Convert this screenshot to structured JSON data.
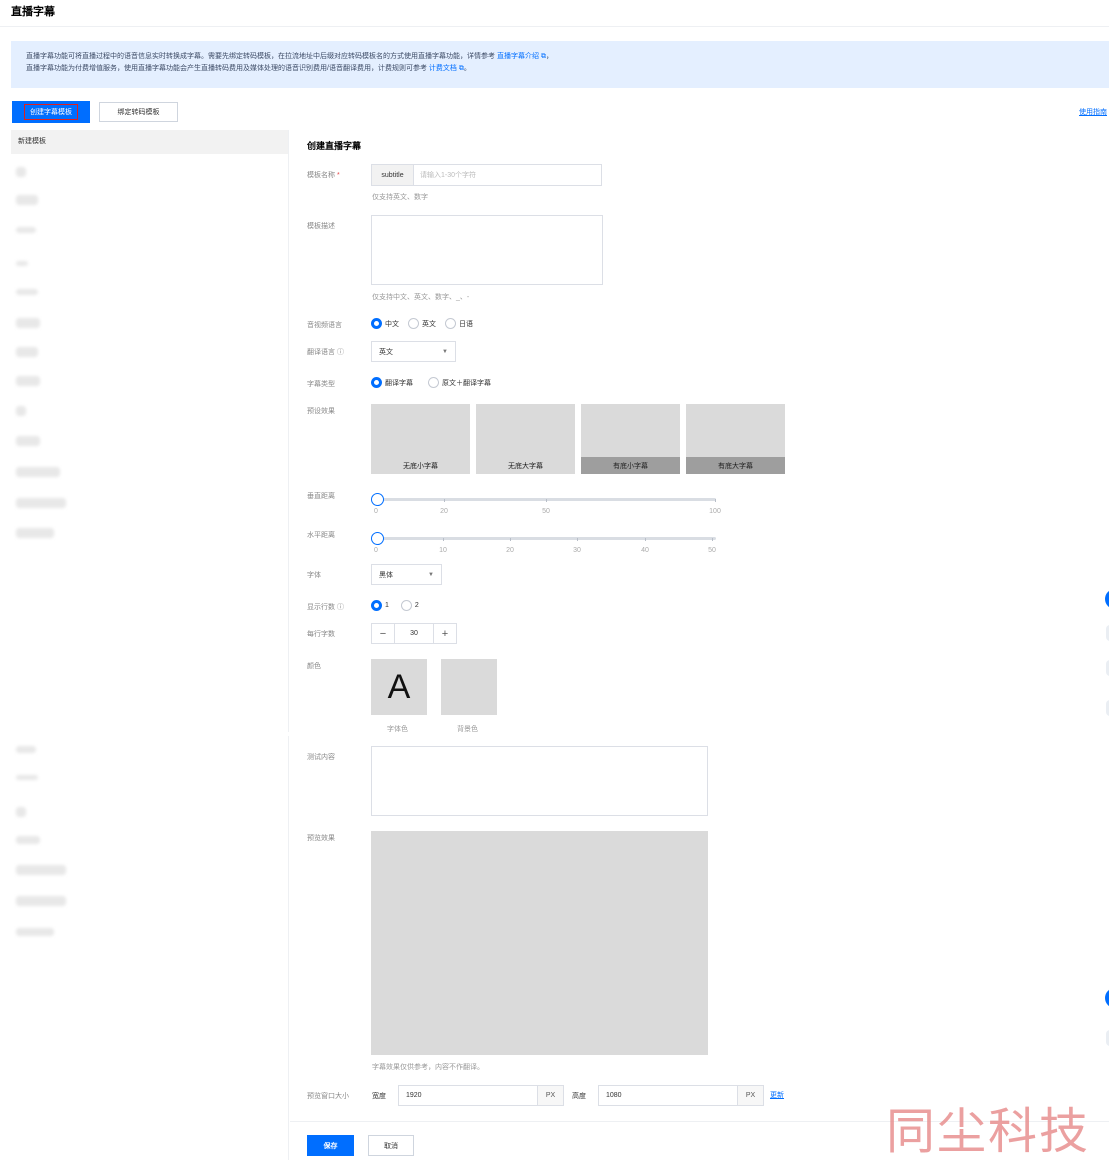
{
  "page": {
    "title": "直播字幕"
  },
  "notice": {
    "line1_text": "直播字幕功能可将直播过程中的语音信息实时转换成字幕。需要先绑定转码模板，在拉流地址中后缀对应转码模板名的方式使用直播字幕功能，详情参考",
    "line1_link": "直播字幕介绍",
    "line1_end": "，",
    "line2_text": "直播字幕功能为付费增值服务，使用直播字幕功能会产生直播转码费用及媒体处理的语音识别费用/语音翻译费用，计费规则可参考",
    "line2_link": "计费文档",
    "line2_end": "。"
  },
  "toolbar": {
    "create_label": "创建字幕模板",
    "bind_label": "绑定转码模板",
    "guide_label": "使用指南"
  },
  "sidebar": {
    "header": "新建模板"
  },
  "form": {
    "title": "创建直播字幕",
    "name": {
      "label": "模板名称",
      "required_mark": "*",
      "prefix": "subtitle",
      "placeholder": "请输入1-30个字符",
      "help": "仅支持英文、数字"
    },
    "description": {
      "label": "模板描述",
      "help": "仅支持中文、英文、数字、_、-"
    },
    "audio_language": {
      "label": "音视频语言",
      "options": [
        "中文",
        "英文",
        "日语"
      ],
      "selected": "中文"
    },
    "translation_language": {
      "label": "翻译语言",
      "value": "英文"
    },
    "subtitle_type": {
      "label": "字幕类型",
      "options": [
        "翻译字幕",
        "原文＋翻译字幕"
      ],
      "selected": "翻译字幕"
    },
    "preset": {
      "label": "预设效果",
      "options": [
        "无底小字幕",
        "无底大字幕",
        "有底小字幕",
        "有底大字幕"
      ]
    },
    "vertical_distance": {
      "label": "垂直距离",
      "value": 0,
      "min": 0,
      "max": 100,
      "ticks": [
        "0",
        "20",
        "50",
        "100"
      ]
    },
    "horizontal_distance": {
      "label": "水平距离",
      "value": 0,
      "min": 0,
      "max": 50,
      "ticks": [
        "0",
        "10",
        "20",
        "30",
        "40",
        "50"
      ]
    },
    "font": {
      "label": "字体",
      "value": "黑体"
    },
    "line_count": {
      "label": "显示行数",
      "options": [
        "1",
        "2"
      ],
      "selected": "1"
    },
    "chars_per_line": {
      "label": "每行字数",
      "value": "30",
      "minus": "−",
      "plus": "+"
    },
    "color": {
      "label": "颜色",
      "font_color_label": "字体色",
      "bg_color_label": "背景色",
      "glyph": "A"
    },
    "test_content": {
      "label": "测试内容"
    },
    "preview": {
      "label": "预览效果",
      "note": "字幕效果仅供参考，内容不作翻译。"
    },
    "window_size": {
      "label": "预览窗口大小",
      "width_label": "宽度",
      "width": "1920",
      "height_label": "高度",
      "height": "1080",
      "unit": "PX",
      "refresh": "更新"
    },
    "save_label": "保存",
    "cancel_label": "取消"
  },
  "watermark": "同尘科技",
  "colors": {
    "primary": "#006eff",
    "notice_bg": "#e4efff",
    "highlight": "#e02020"
  }
}
